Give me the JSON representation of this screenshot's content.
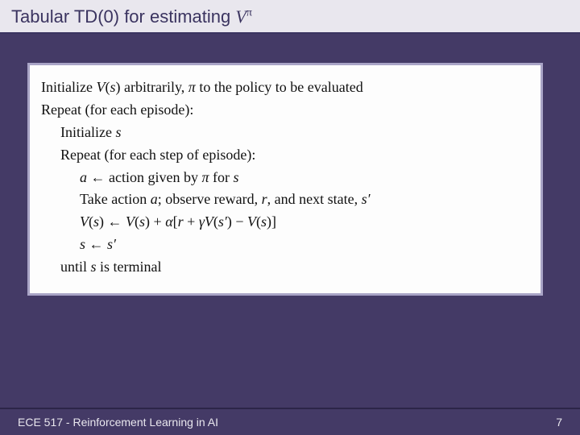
{
  "title": {
    "prefix": "Tabular TD(0) for estimating ",
    "var": "V",
    "sup": "π"
  },
  "algorithm": {
    "line1_a": "Initialize ",
    "line1_b": "V",
    "line1_c": "(",
    "line1_d": "s",
    "line1_e": ") arbitrarily, ",
    "line1_f": "π",
    "line1_g": " to the policy to be evaluated",
    "line2": "Repeat (for each episode):",
    "line3_a": "Initialize ",
    "line3_b": "s",
    "line4": "Repeat (for each step of episode):",
    "line5_a": "a",
    "line5_b": " ← action given by ",
    "line5_c": "π",
    "line5_d": " for ",
    "line5_e": "s",
    "line6_a": "Take action ",
    "line6_b": "a",
    "line6_c": "; observe reward, ",
    "line6_d": "r",
    "line6_e": ", and next state, ",
    "line6_f": "s′",
    "line7_a": "V",
    "line7_b": "(",
    "line7_c": "s",
    "line7_d": ") ← ",
    "line7_e": "V",
    "line7_f": "(",
    "line7_g": "s",
    "line7_h": ") + ",
    "line7_i": "α",
    "line7_j": "[",
    "line7_k": "r",
    "line7_l": " + ",
    "line7_m": "γ",
    "line7_n": "V",
    "line7_o": "(",
    "line7_p": "s′",
    "line7_q": ") − ",
    "line7_r": "V",
    "line7_s": "(",
    "line7_t": "s",
    "line7_u": ")]",
    "line8_a": "s",
    "line8_b": " ← ",
    "line8_c": "s′",
    "line9_a": "until ",
    "line9_b": "s",
    "line9_c": " is terminal"
  },
  "footer": {
    "left": "ECE 517 - Reinforcement Learning in AI",
    "right": "7"
  }
}
